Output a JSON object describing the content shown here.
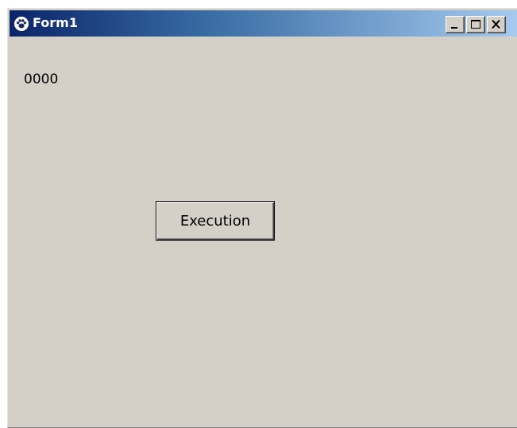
{
  "window": {
    "title": "Form1",
    "icon": "paw-icon",
    "controls": {
      "minimize": "minimize-icon",
      "maximize": "maximize-icon",
      "close": "close-icon"
    }
  },
  "form": {
    "label_value": "0000",
    "execute_button_label": "Execution"
  },
  "colors": {
    "face": "#d4d0c8",
    "title_start": "#0a246a",
    "title_end": "#a6caf0"
  }
}
